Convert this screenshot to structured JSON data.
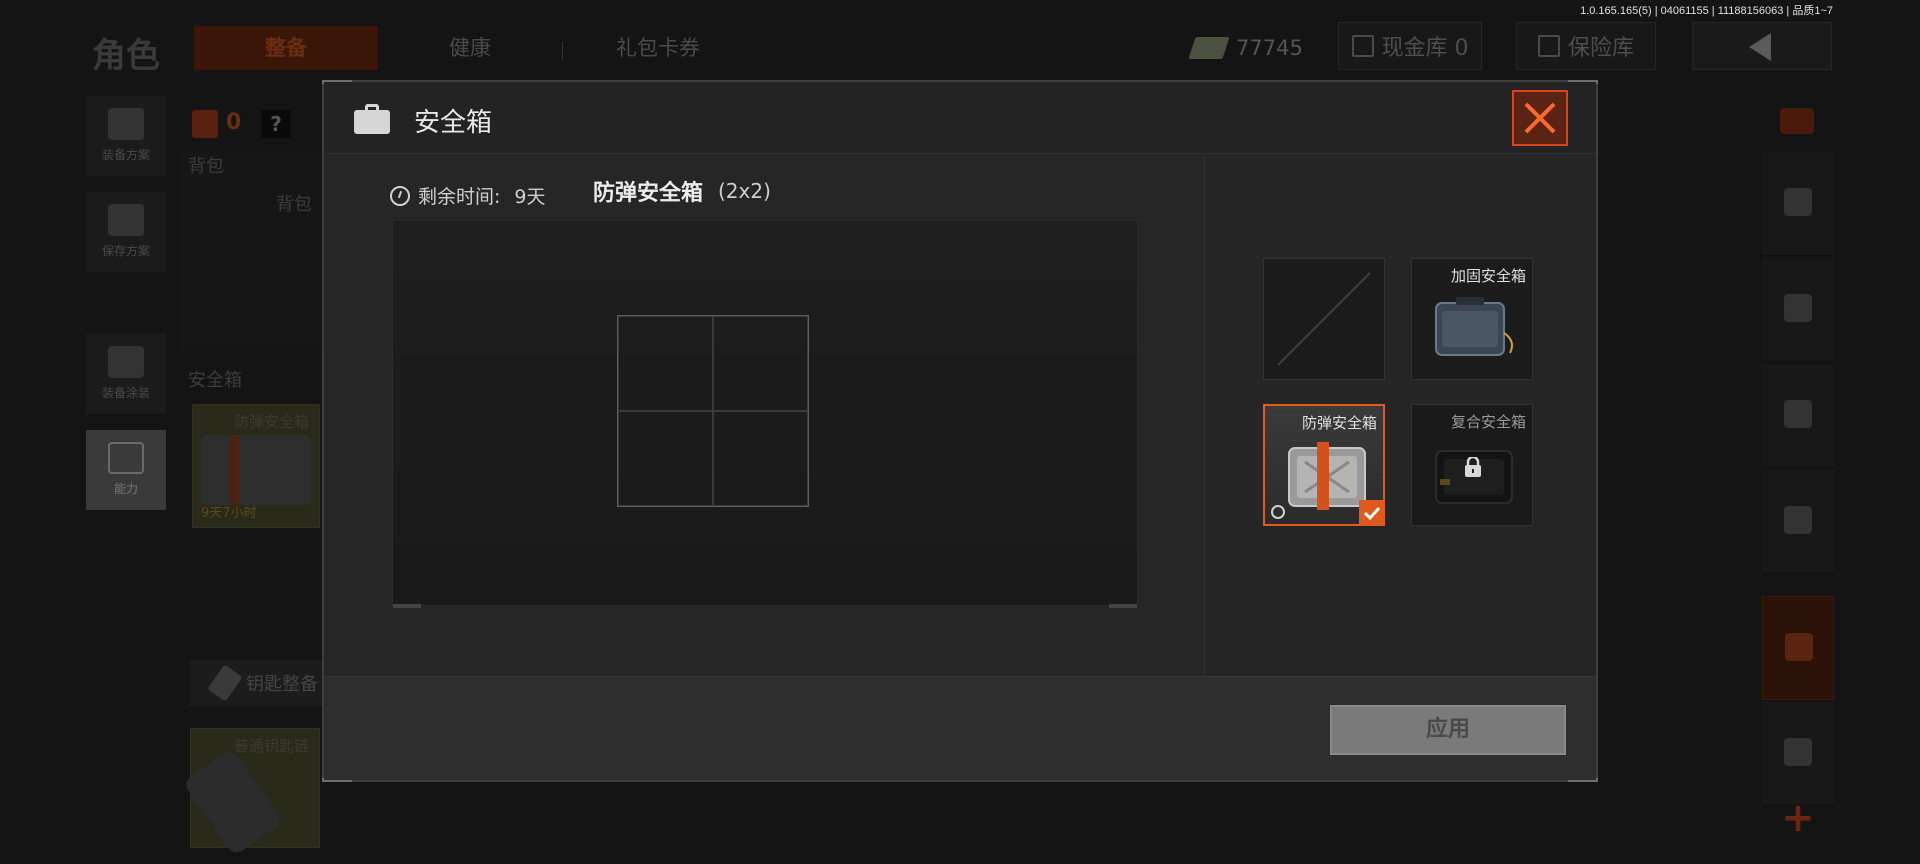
{
  "version": "1.0.165.165(5) | 04061155 | 11188156063 | 品质1~7",
  "background": {
    "role_title": "角色",
    "tabs": [
      {
        "label": "整备",
        "active": true
      },
      {
        "label": "健康",
        "active": false
      },
      {
        "label": "礼包卡券",
        "active": false
      }
    ],
    "currency_value": "77745",
    "cash_vault": "现金库 0",
    "insurance_vault": "保险库",
    "left_items": [
      {
        "label": "装备方案",
        "icon": "backpack-icon"
      },
      {
        "label": "保存方案",
        "icon": "download-icon"
      },
      {
        "label": "装备涂装",
        "icon": "helmet-icon"
      },
      {
        "label": "能力",
        "icon": "lightning-icon"
      }
    ],
    "vest_count": "0",
    "help": "?",
    "backpack_header": "背包",
    "backpack_label": "背包",
    "safebox_header": "安全箱",
    "equipped_safebox_name": "防弹安全箱",
    "equipped_safebox_time": "9天7小时",
    "key_section": "钥匙整备",
    "keychain_name": "普通钥匙链"
  },
  "modal": {
    "title": "安全箱",
    "timer_label": "剩余时间:",
    "timer_value": "9天",
    "case_name": "防弹安全箱",
    "case_size": "(2x2)",
    "grid": {
      "cols": 2,
      "rows": 2
    },
    "cases": [
      {
        "name": "",
        "state": "empty"
      },
      {
        "name": "加固安全箱",
        "state": "available"
      },
      {
        "name": "防弹安全箱",
        "state": "selected"
      },
      {
        "name": "复合安全箱",
        "state": "locked"
      }
    ],
    "apply_label": "应用",
    "colors": {
      "accent": "#e05a1c",
      "panel": "#262626",
      "close": "#d8451a"
    }
  }
}
